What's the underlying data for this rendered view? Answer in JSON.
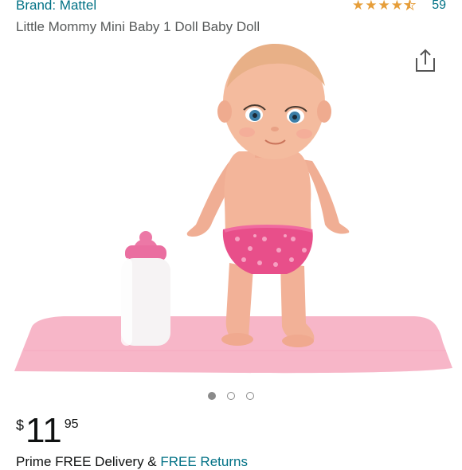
{
  "brand": {
    "label": "Brand: Mattel"
  },
  "rating": {
    "stars": 4.5,
    "count": "59"
  },
  "product": {
    "title": "Little Mommy Mini Baby 1 Doll Baby Doll"
  },
  "gallery": {
    "dot_count": 3,
    "active_index": 0
  },
  "price": {
    "symbol": "$",
    "whole": "11",
    "fraction": "95"
  },
  "delivery": {
    "prefix": "Prime FREE Delivery &",
    "link": "FREE Returns"
  },
  "icons": {
    "share": "share-icon",
    "star": "star-icon"
  },
  "colors": {
    "link": "#007185",
    "star": "#e69e3a",
    "title_gray": "#565959"
  }
}
